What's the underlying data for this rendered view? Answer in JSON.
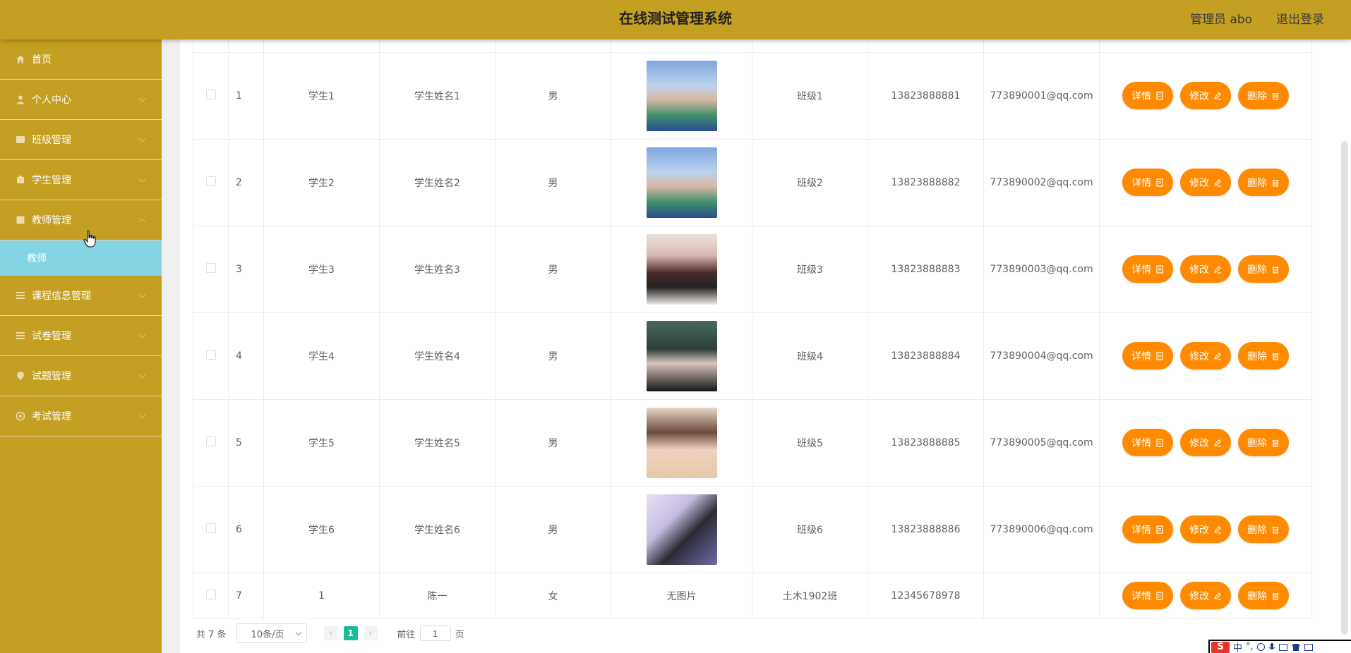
{
  "header": {
    "title": "在线测试管理系统",
    "admin_label": "管理员 abo",
    "logout_label": "退出登录"
  },
  "sidebar": {
    "items": [
      {
        "label": "首页",
        "icon": "home-icon"
      },
      {
        "label": "个人中心",
        "icon": "user-icon"
      },
      {
        "label": "班级管理",
        "icon": "class-icon"
      },
      {
        "label": "学生管理",
        "icon": "student-icon"
      },
      {
        "label": "教师管理",
        "icon": "teacher-icon"
      },
      {
        "label": "课程信息管理",
        "icon": "course-icon"
      },
      {
        "label": "试卷管理",
        "icon": "paper-icon"
      },
      {
        "label": "试题管理",
        "icon": "question-icon"
      },
      {
        "label": "考试管理",
        "icon": "exam-icon"
      }
    ],
    "submenu_active": "教师"
  },
  "table": {
    "rows": [
      {
        "index": "1",
        "account": "学生1",
        "name": "学生姓名1",
        "gender": "男",
        "class": "班级1",
        "phone": "13823888881",
        "email": "773890001@qq.com"
      },
      {
        "index": "2",
        "account": "学生2",
        "name": "学生姓名2",
        "gender": "男",
        "class": "班级2",
        "phone": "13823888882",
        "email": "773890002@qq.com"
      },
      {
        "index": "3",
        "account": "学生3",
        "name": "学生姓名3",
        "gender": "男",
        "class": "班级3",
        "phone": "13823888883",
        "email": "773890003@qq.com"
      },
      {
        "index": "4",
        "account": "学生4",
        "name": "学生姓名4",
        "gender": "男",
        "class": "班级4",
        "phone": "13823888884",
        "email": "773890004@qq.com"
      },
      {
        "index": "5",
        "account": "学生5",
        "name": "学生姓名5",
        "gender": "男",
        "class": "班级5",
        "phone": "13823888885",
        "email": "773890005@qq.com"
      },
      {
        "index": "6",
        "account": "学生6",
        "name": "学生姓名6",
        "gender": "男",
        "class": "班级6",
        "phone": "13823888886",
        "email": "773890006@qq.com"
      },
      {
        "index": "7",
        "account": "1",
        "name": "陈一",
        "gender": "女",
        "photo_text": "无图片",
        "class": "土木1902班",
        "phone": "12345678978",
        "email": ""
      }
    ],
    "actions": {
      "detail": "详情",
      "edit": "修改",
      "delete": "删除"
    }
  },
  "pagination": {
    "total": "共 7 条",
    "page_size": "10条/页",
    "prev": "‹",
    "current_page": "1",
    "next": "›",
    "goto_prefix": "前往",
    "goto_value": "1",
    "goto_suffix": "页"
  },
  "ime_bar": {
    "logo": "S",
    "mode": "中",
    "punct": "°,"
  },
  "colors": {
    "header_bg": "#c49f22",
    "sidebar_bg": "#c49f22",
    "submenu_active_bg": "#84d4e3",
    "action_button": "#ff8a00",
    "page_active": "#1abc9c"
  }
}
